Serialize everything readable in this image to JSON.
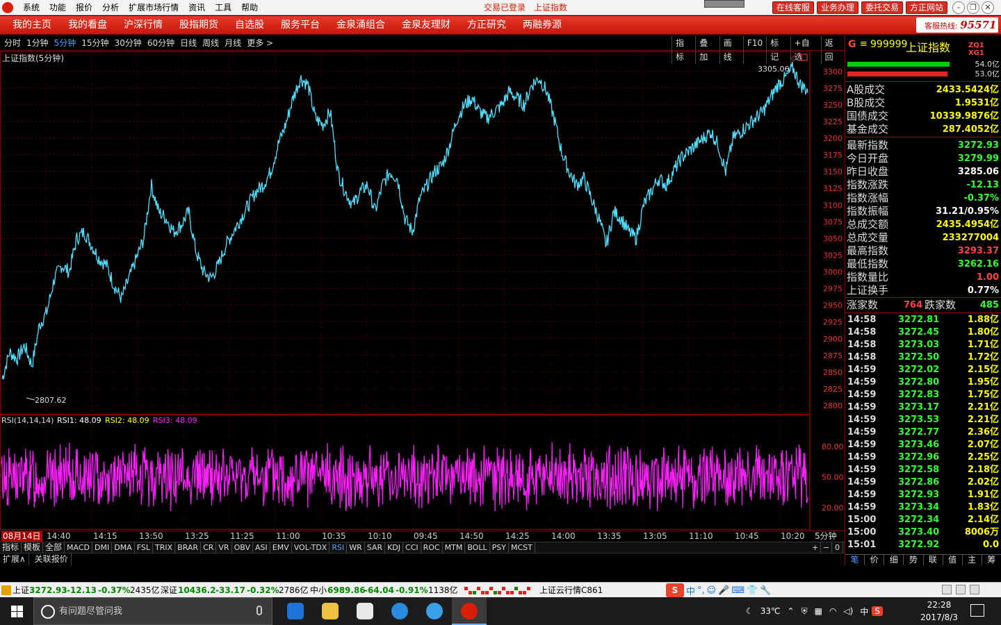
{
  "titlebar": {
    "menu": [
      "系统",
      "功能",
      "报价",
      "分析",
      "扩展市场行情",
      "资讯",
      "工具",
      "帮助"
    ],
    "status": [
      "交易已登录",
      "上证指数"
    ],
    "buttons": [
      "在线客服",
      "业务办理",
      "委托交易",
      "方正网站"
    ]
  },
  "navbar": {
    "items": [
      "我的主页",
      "我的看盘",
      "沪深行情",
      "股指期货",
      "自选股",
      "服务平台",
      "金泉涌组合",
      "金泉友理财",
      "方正研究",
      "两融券源"
    ],
    "hotline_label": "客服热线:",
    "hotline_number": "95571"
  },
  "periodbar": {
    "periods": [
      "分时",
      "1分钟",
      "5分钟",
      "15分钟",
      "30分钟",
      "60分钟",
      "日线",
      "周线",
      "月线",
      "更多 >"
    ],
    "active_index": 2,
    "tools": [
      "指标",
      "叠加",
      "画线",
      "F10",
      "标记",
      "+自选",
      "返回"
    ]
  },
  "chart": {
    "title": "上证指数(5分钟)",
    "high_label": "3305.06",
    "low_label": "2807.62",
    "y_ticks": [
      "3300",
      "3275",
      "3250",
      "3225",
      "3200",
      "3175",
      "3150",
      "3125",
      "3100",
      "3075",
      "3050",
      "3025",
      "3000",
      "2975",
      "2950",
      "2925",
      "2900",
      "2875",
      "2850",
      "2825",
      "2800"
    ],
    "price_color": "#4fe0ff",
    "rsi": {
      "title": "RSI(14,14,14)",
      "rsi1_label": "RSI1: 48.09",
      "rsi2_label": "RSI2: 48.09",
      "rsi3_label": "RSI3: 48.09",
      "y_ticks": [
        "80.00",
        "50.00",
        "20.00"
      ],
      "color": "#ff1fff"
    }
  },
  "chart_data": {
    "type": "line",
    "title": "上证指数(5分钟)",
    "ylim": [
      2800,
      3305
    ],
    "series": [
      {
        "name": "上证指数",
        "values": [
          2840,
          2880,
          2870,
          2890,
          2860,
          2920,
          2940,
          2990,
          3010,
          3000,
          3050,
          3060,
          3040,
          3020,
          3010,
          2980,
          2960,
          2990,
          3020,
          3050,
          3130,
          3090,
          3080,
          3060,
          3070,
          3090,
          3030,
          3000,
          2990,
          3010,
          3040,
          3060,
          3080,
          3100,
          3120,
          3130,
          3150,
          3190,
          3220,
          3260,
          3290,
          3280,
          3230,
          3220,
          3240,
          3150,
          3120,
          3100,
          3120,
          3130,
          3090,
          3130,
          3150,
          3140,
          3080,
          3060,
          3110,
          3130,
          3150,
          3160,
          3190,
          3230,
          3250,
          3260,
          3240,
          3230,
          3240,
          3250,
          3270,
          3260,
          3250,
          3280,
          3290,
          3270,
          3230,
          3180,
          3150,
          3130,
          3140,
          3110,
          3080,
          3040,
          3090,
          3080,
          3060,
          3050,
          3100,
          3120,
          3140,
          3130,
          3150,
          3170,
          3180,
          3190,
          3200,
          3210,
          3190,
          3150,
          3200,
          3210,
          3220,
          3230,
          3240,
          3260,
          3280,
          3290,
          3305,
          3280,
          3272
        ]
      }
    ],
    "rsi_ylim": [
      0,
      100
    ],
    "rsi_series": [
      {
        "name": "RSI1",
        "last": 48.09
      }
    ]
  },
  "timeaxis": {
    "date": "08月14日",
    "labels": [
      "14:40",
      "14:15",
      "13:50",
      "13:25",
      "11:25",
      "11:00",
      "10:35",
      "10:10",
      "09:45",
      "14:50",
      "14:25",
      "14:00",
      "13:35",
      "13:05",
      "11:10",
      "10:45",
      "10:20"
    ],
    "period": "5分钟"
  },
  "indtabs": {
    "lead": [
      "指标",
      "模板",
      "全部"
    ],
    "items": [
      "MACD",
      "DMI",
      "DMA",
      "FSL",
      "TRIX",
      "BRAR",
      "CR",
      "VR",
      "OBV",
      "ASI",
      "EMV",
      "VOL-TDX",
      "RSI",
      "WR",
      "SAR",
      "KDJ",
      "CCI",
      "ROC",
      "MTM",
      "BOLL",
      "PSY",
      "MCST"
    ],
    "active": "RSI",
    "ctrls": [
      "+",
      "−",
      "0"
    ]
  },
  "extrow": [
    "扩展∧",
    "关联报价"
  ],
  "rpanel": {
    "flag": "G",
    "eq": "≡",
    "code": "999999",
    "name": "上证指数",
    "zq": "ZQ1 XG1",
    "bar_values": [
      "54.0亿",
      "53.0亿"
    ],
    "bar_fractions": [
      0.98,
      0.96
    ],
    "turnover": [
      {
        "label": "A股成交",
        "value": "2433.5424亿"
      },
      {
        "label": "B股成交",
        "value": "1.9531亿"
      },
      {
        "label": "国债成交",
        "value": "10339.9876亿"
      },
      {
        "label": "基金成交",
        "value": "287.4052亿"
      }
    ],
    "stats": [
      {
        "label": "最新指数",
        "value": "3272.93",
        "color": "#3f3"
      },
      {
        "label": "今日开盘",
        "value": "3279.99",
        "color": "#3f3"
      },
      {
        "label": "昨日收盘",
        "value": "3285.06",
        "color": "#fff"
      },
      {
        "label": "指数涨跌",
        "value": "-12.13",
        "color": "#3f3"
      },
      {
        "label": "指数涨幅",
        "value": "-0.37%",
        "color": "#3f3"
      },
      {
        "label": "指数振幅",
        "value": "31.21/0.95%",
        "color": "#fff"
      },
      {
        "label": "总成交额",
        "value": "2435.4954亿",
        "color": "#ff0"
      },
      {
        "label": "总成交量",
        "value": "233277004",
        "color": "#ff0"
      },
      {
        "label": "最高指数",
        "value": "3293.37",
        "color": "#f44"
      },
      {
        "label": "最低指数",
        "value": "3262.16",
        "color": "#3f3"
      },
      {
        "label": "指数量比",
        "value": "1.00",
        "color": "#f44"
      },
      {
        "label": "上证换手",
        "value": "0.77%",
        "color": "#fff"
      }
    ],
    "up_label": "涨家数",
    "up_value": "764",
    "down_label": "跌家数",
    "down_value": "485",
    "ticks": [
      {
        "time": "14:58",
        "price": "3272.81",
        "vol": "1.88亿"
      },
      {
        "time": "14:58",
        "price": "3272.45",
        "vol": "1.80亿"
      },
      {
        "time": "14:58",
        "price": "3273.03",
        "vol": "1.71亿"
      },
      {
        "time": "14:58",
        "price": "3272.50",
        "vol": "1.72亿"
      },
      {
        "time": "14:59",
        "price": "3272.02",
        "vol": "2.15亿"
      },
      {
        "time": "14:59",
        "price": "3272.80",
        "vol": "1.95亿"
      },
      {
        "time": "14:59",
        "price": "3272.83",
        "vol": "1.75亿"
      },
      {
        "time": "14:59",
        "price": "3273.17",
        "vol": "2.21亿"
      },
      {
        "time": "14:59",
        "price": "3273.53",
        "vol": "2.21亿"
      },
      {
        "time": "14:59",
        "price": "3272.77",
        "vol": "2.36亿"
      },
      {
        "time": "14:59",
        "price": "3273.46",
        "vol": "2.07亿"
      },
      {
        "time": "14:59",
        "price": "3272.96",
        "vol": "2.25亿"
      },
      {
        "time": "14:59",
        "price": "3272.58",
        "vol": "2.18亿"
      },
      {
        "time": "14:59",
        "price": "3272.86",
        "vol": "2.02亿"
      },
      {
        "time": "14:59",
        "price": "3272.93",
        "vol": "1.91亿"
      },
      {
        "time": "14:59",
        "price": "3273.34",
        "vol": "1.83亿"
      },
      {
        "time": "15:00",
        "price": "3272.34",
        "vol": "2.14亿"
      },
      {
        "time": "15:00",
        "price": "3273.40",
        "vol": "8006万"
      },
      {
        "time": "15:01",
        "price": "3272.92",
        "vol": "0.0"
      }
    ],
    "tabs": [
      "笔",
      "价",
      "细",
      "势",
      "联",
      "值",
      "主",
      "筹"
    ]
  },
  "ticker": {
    "sh_label": "上证",
    "sh_price": "3272.93",
    "sh_chg": "-12.13",
    "sh_pct": "-0.37%",
    "sh_amt": "2435亿",
    "sz_label": "深证",
    "sz_price": "10436.2",
    "sz_chg": "-33.17",
    "sz_pct": "-0.32%",
    "sz_amt": "2786亿",
    "zx_label": "中小",
    "zx_price": "6989.86",
    "zx_chg": "-64.04",
    "zx_pct": "-0.91%",
    "zx_amt": "1138亿",
    "cloud": "上证云行情C861",
    "ime_s": "S",
    "ime_items": [
      "中",
      "°,",
      "☺",
      "🎤",
      "⌨",
      "👕",
      "🔧"
    ]
  },
  "taskbar": {
    "search_placeholder": "有问题尽管问我",
    "weather": "33℃",
    "lang": "中",
    "time": "22:28",
    "date": "2017/8/3"
  }
}
